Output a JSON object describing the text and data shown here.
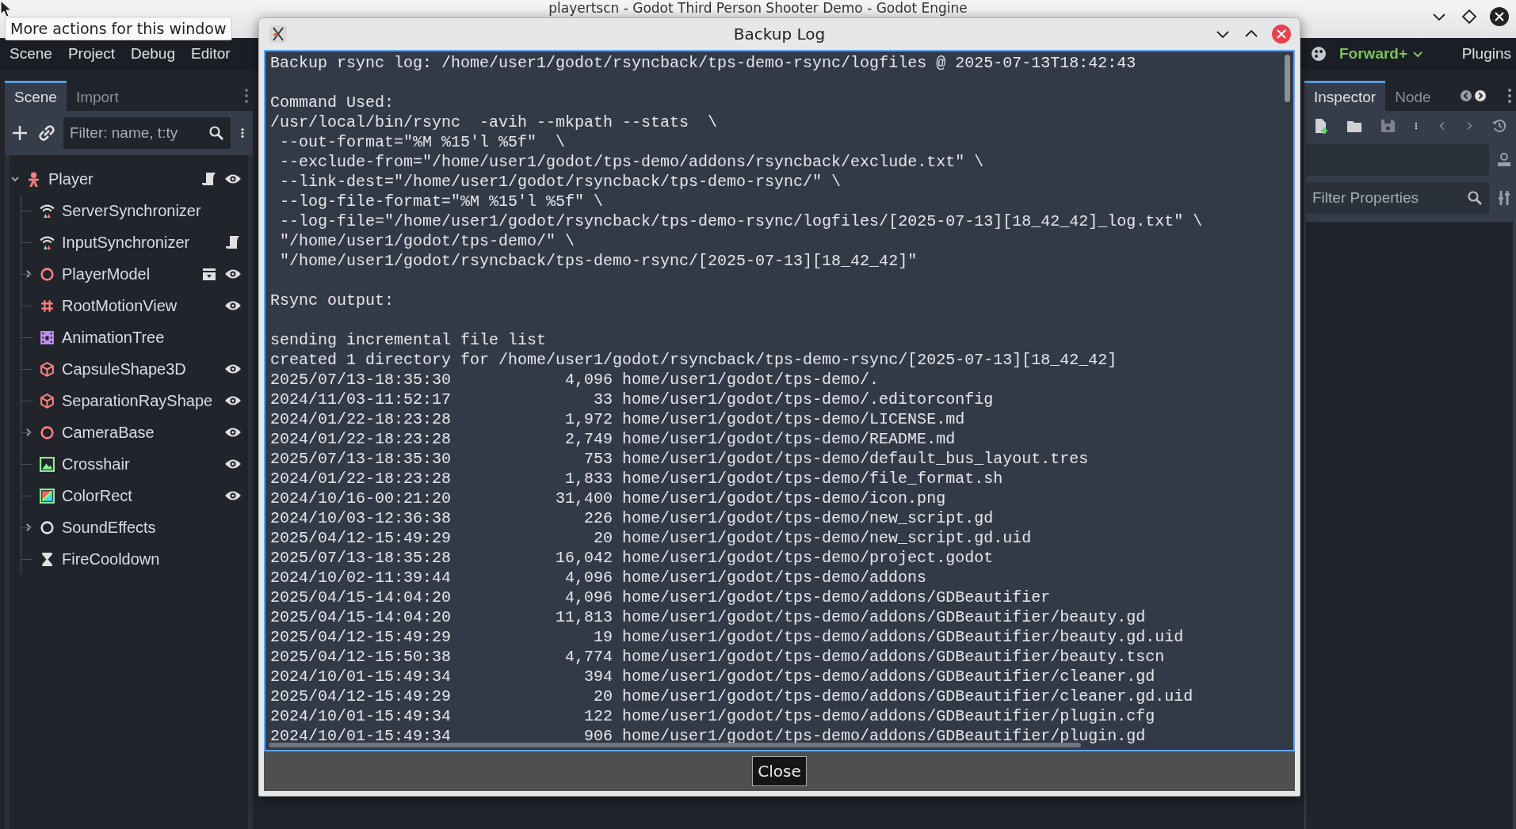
{
  "main_window": {
    "title": "playertscn - Godot Third Person Shooter Demo - Godot Engine"
  },
  "tooltip": "More actions for this window",
  "menu": [
    "Scene",
    "Project",
    "Debug",
    "Editor"
  ],
  "toolbar_right": {
    "renderer": "Forward+",
    "plugins": "Plugins"
  },
  "scene_dock": {
    "tabs": [
      {
        "label": "Scene",
        "selected": true
      },
      {
        "label": "Import",
        "selected": false
      }
    ],
    "filter": {
      "placeholder": "Filter: name, t:ty"
    },
    "tree": [
      {
        "name": "Player",
        "kind": "player",
        "expanded": true,
        "script": true,
        "visible": true,
        "children": [
          {
            "name": "ServerSynchronizer",
            "kind": "sync"
          },
          {
            "name": "InputSynchronizer",
            "kind": "sync",
            "script": true
          },
          {
            "name": "PlayerModel",
            "kind": "node3d",
            "expanded": false,
            "scene": true,
            "visible": true
          },
          {
            "name": "RootMotionView",
            "kind": "grid",
            "visible": true
          },
          {
            "name": "AnimationTree",
            "kind": "animtree"
          },
          {
            "name": "CapsuleShape3D",
            "kind": "shape",
            "visible": true
          },
          {
            "name": "SeparationRayShape",
            "kind": "shape",
            "visible": true
          },
          {
            "name": "CameraBase",
            "kind": "node3d",
            "expanded": false,
            "visible": true
          },
          {
            "name": "Crosshair",
            "kind": "texture",
            "visible": true
          },
          {
            "name": "ColorRect",
            "kind": "colorrect",
            "visible": true
          },
          {
            "name": "SoundEffects",
            "kind": "node",
            "expanded": false
          },
          {
            "name": "FireCooldown",
            "kind": "timer"
          }
        ]
      }
    ]
  },
  "inspector_dock": {
    "tabs": [
      {
        "label": "Inspector",
        "selected": true
      },
      {
        "label": "Node",
        "selected": false
      }
    ],
    "filter": {
      "placeholder": "Filter Properties"
    }
  },
  "dialog": {
    "title": "Backup Log",
    "header": "Backup rsync log: /home/user1/godot/rsyncback/tps-demo-rsync/logfiles @ 2025-07-13T18:42:43",
    "command": {
      "label": "Command Used:",
      "lines": [
        "/usr/local/bin/rsync  -avih --mkpath --stats  \\",
        "--out-format=\"%M %15'l %5f\"  \\",
        "--exclude-from=\"/home/user1/godot/tps-demo/addons/rsyncback/exclude.txt\" \\",
        "--link-dest=\"/home/user1/godot/rsyncback/tps-demo-rsync/\" \\",
        "--log-file-format=\"%M %15'l %5f\" \\",
        "--log-file=\"/home/user1/godot/rsyncback/tps-demo-rsync/logfiles/[2025-07-13][18_42_42]_log.txt\" \\",
        "\"/home/user1/godot/tps-demo/\" \\",
        "\"/home/user1/godot/rsyncback/tps-demo-rsync/[2025-07-13][18_42_42]\""
      ]
    },
    "output_label": "Rsync output:",
    "output_lines": [
      "sending incremental file list",
      "created 1 directory for /home/user1/godot/rsyncback/tps-demo-rsync/[2025-07-13][18_42_42]"
    ],
    "files": [
      {
        "date": "2025/07/13-18:35:30",
        "size": "4,096",
        "path": "home/user1/godot/tps-demo/."
      },
      {
        "date": "2024/11/03-11:52:17",
        "size": "33",
        "path": "home/user1/godot/tps-demo/.editorconfig"
      },
      {
        "date": "2024/01/22-18:23:28",
        "size": "1,972",
        "path": "home/user1/godot/tps-demo/LICENSE.md"
      },
      {
        "date": "2024/01/22-18:23:28",
        "size": "2,749",
        "path": "home/user1/godot/tps-demo/README.md"
      },
      {
        "date": "2025/07/13-18:35:30",
        "size": "753",
        "path": "home/user1/godot/tps-demo/default_bus_layout.tres"
      },
      {
        "date": "2024/01/22-18:23:28",
        "size": "1,833",
        "path": "home/user1/godot/tps-demo/file_format.sh"
      },
      {
        "date": "2024/10/16-00:21:20",
        "size": "31,400",
        "path": "home/user1/godot/tps-demo/icon.png"
      },
      {
        "date": "2024/10/03-12:36:38",
        "size": "226",
        "path": "home/user1/godot/tps-demo/new_script.gd"
      },
      {
        "date": "2025/04/12-15:49:29",
        "size": "20",
        "path": "home/user1/godot/tps-demo/new_script.gd.uid"
      },
      {
        "date": "2025/07/13-18:35:28",
        "size": "16,042",
        "path": "home/user1/godot/tps-demo/project.godot"
      },
      {
        "date": "2024/10/02-11:39:44",
        "size": "4,096",
        "path": "home/user1/godot/tps-demo/addons"
      },
      {
        "date": "2025/04/15-14:04:20",
        "size": "4,096",
        "path": "home/user1/godot/tps-demo/addons/GDBeautifier"
      },
      {
        "date": "2025/04/15-14:04:20",
        "size": "11,813",
        "path": "home/user1/godot/tps-demo/addons/GDBeautifier/beauty.gd"
      },
      {
        "date": "2025/04/12-15:49:29",
        "size": "19",
        "path": "home/user1/godot/tps-demo/addons/GDBeautifier/beauty.gd.uid"
      },
      {
        "date": "2025/04/12-15:50:38",
        "size": "4,774",
        "path": "home/user1/godot/tps-demo/addons/GDBeautifier/beauty.tscn"
      },
      {
        "date": "2024/10/01-15:49:34",
        "size": "394",
        "path": "home/user1/godot/tps-demo/addons/GDBeautifier/cleaner.gd"
      },
      {
        "date": "2025/04/12-15:49:29",
        "size": "20",
        "path": "home/user1/godot/tps-demo/addons/GDBeautifier/cleaner.gd.uid"
      },
      {
        "date": "2024/10/01-15:49:34",
        "size": "122",
        "path": "home/user1/godot/tps-demo/addons/GDBeautifier/plugin.cfg"
      },
      {
        "date": "2024/10/01-15:49:34",
        "size": "906",
        "path": "home/user1/godot/tps-demo/addons/GDBeautifier/plugin.gd"
      }
    ],
    "button": "Close"
  }
}
